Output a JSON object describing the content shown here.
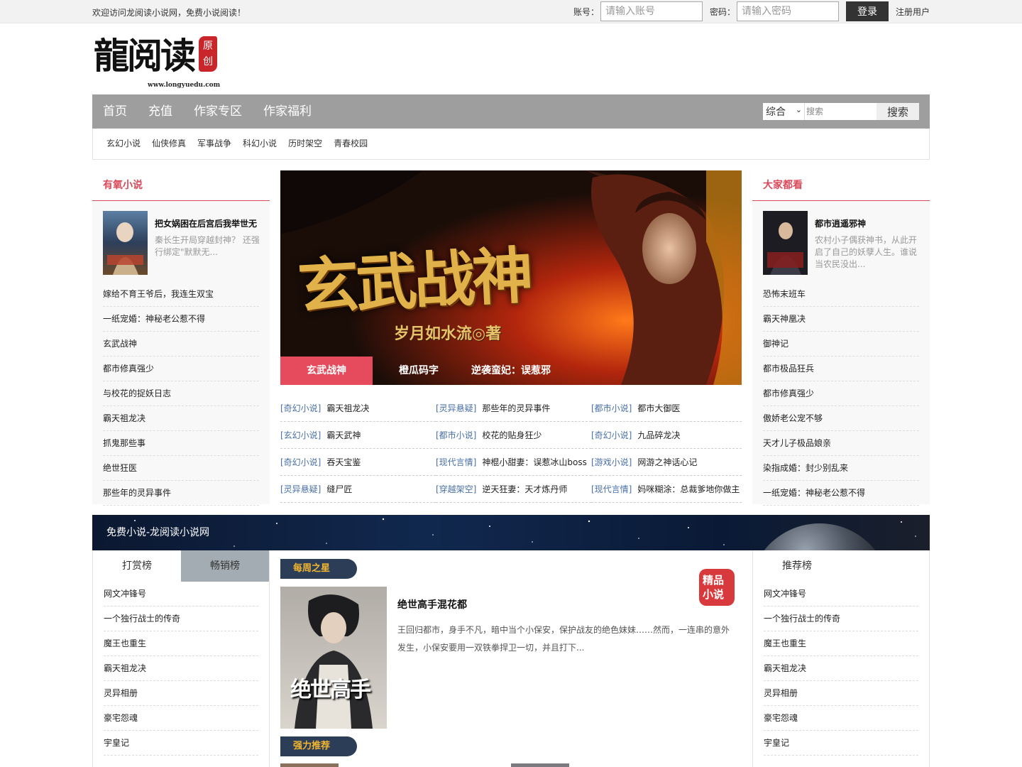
{
  "topbar": {
    "welcome": "欢迎访问龙阅读小说网，免费小说阅读！",
    "account_label": "账号：",
    "account_placeholder": "请输入账号",
    "password_label": "密码：",
    "password_placeholder": "请输入密码",
    "login_button": "登录",
    "register_link": "注册用户"
  },
  "logo": {
    "text": "龍阅读",
    "seal": "原创",
    "url": "www.longyuedu.com"
  },
  "nav": {
    "items": [
      "首页",
      "充值",
      "作家专区",
      "作家福利"
    ],
    "search_select": "综合",
    "search_placeholder": "搜索",
    "search_button": "搜索"
  },
  "subnav": [
    "玄幻小说",
    "仙侠修真",
    "军事战争",
    "科幻小说",
    "历时架空",
    "青春校园"
  ],
  "left_box": {
    "title": "有氧小说",
    "feature": {
      "title": "把女娲困在后宫后我举世无",
      "desc": "秦长生开局穿越封神？ 还强行绑定\"默默无..."
    },
    "list": [
      "嫁给不育王爷后，我连生双宝",
      "一纸宠婚：神秘老公惹不得",
      "玄武战神",
      "都市修真强少",
      "与校花的捉妖日志",
      "霸天祖龙决",
      "抓鬼那些事",
      "绝世狂医",
      "那些年的灵异事件"
    ]
  },
  "right_box": {
    "title": "大家都看",
    "feature": {
      "title": "都市逍遥邪神",
      "desc": "农村小子偶获神书，从此开启了自己的妖孽人生。谁说当农民没出..."
    },
    "list": [
      "恐怖末班车",
      "霸天神凰决",
      "御神记",
      "都市极品狂兵",
      "都市修真强少",
      "傲娇老公宠不够",
      "天才儿子极品娘亲",
      "染指成婚：封少别乱来",
      "一纸宠婚：神秘老公惹不得"
    ]
  },
  "banner": {
    "title": "玄武战神",
    "author": "岁月如水流◎著",
    "tabs": [
      "玄武战神",
      "橙瓜码字",
      "逆袭蛮妃：误惹邪"
    ]
  },
  "categories": [
    {
      "tag": "[奇幻小说]",
      "name": "霸天祖龙决"
    },
    {
      "tag": "[灵异悬疑]",
      "name": "那些年的灵异事件"
    },
    {
      "tag": "[都市小说]",
      "name": "都市大御医"
    },
    {
      "tag": "[玄幻小说]",
      "name": "霸天武神"
    },
    {
      "tag": "[都市小说]",
      "name": "校花的贴身狂少"
    },
    {
      "tag": "[奇幻小说]",
      "name": "九品碎龙决"
    },
    {
      "tag": "[奇幻小说]",
      "name": "吞天宝鉴"
    },
    {
      "tag": "[现代言情]",
      "name": "神棍小甜妻：误惹冰山boss"
    },
    {
      "tag": "[游戏小说]",
      "name": "网游之神话心记"
    },
    {
      "tag": "[灵异悬疑]",
      "name": "缝尸匠"
    },
    {
      "tag": "[穿越架空]",
      "name": "逆天狂妻：天才炼丹师"
    },
    {
      "tag": "[现代言情]",
      "name": "妈咪糊涂：总裁爹地你做主"
    }
  ],
  "strip": {
    "text": "免费小说-龙阅读小说网"
  },
  "left_rank": {
    "tabs": [
      "打赏榜",
      "畅销榜"
    ],
    "list": [
      "网文冲锋号",
      "一个独行战士的传奇",
      "魔王也重生",
      "霸天祖龙决",
      "灵异相册",
      "豪宅怨魂",
      "宇皇记"
    ]
  },
  "right_rank": {
    "title": "推荐榜",
    "list": [
      "网文冲锋号",
      "一个独行战士的传奇",
      "魔王也重生",
      "霸天祖龙决",
      "灵异相册",
      "豪宅怨魂",
      "宇皇记"
    ]
  },
  "weekly": {
    "badge": "每周之星",
    "title": "绝世高手混花都",
    "desc": "王回归都市，身手不凡，暗中当个小保安，保护战友的绝色妹妹……然而，一连串的意外发生，小保安要用一双铁拳捍卫一切，并且打下...",
    "cover_text": "绝世高手",
    "seal": "精品小说",
    "badge2": "强力推荐"
  },
  "colors": {
    "accent": "#d84a5a",
    "nav_bg": "#9e9e9e",
    "tag_blue": "#4a6fa5",
    "badge_bg": "#2c3e57",
    "badge_text": "#f2b530"
  }
}
